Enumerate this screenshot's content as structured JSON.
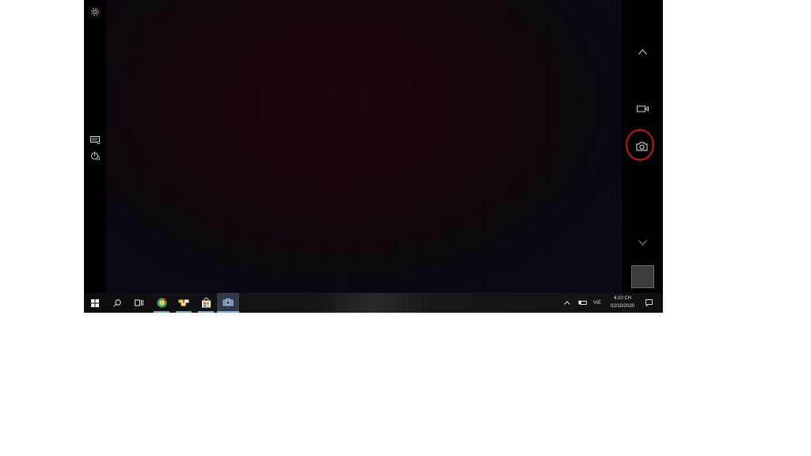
{
  "camera": {
    "side_tools": [
      "settings-icon",
      "hdr-icon",
      "self-timer-icon"
    ],
    "modes": [
      "chevron-up-icon",
      "video-icon",
      "photo-icon",
      "chevron-down-icon"
    ]
  },
  "taskbar": {
    "apps": [
      "start-icon",
      "search-icon",
      "task-view-icon",
      "chrome-icon",
      "file-explorer-icon",
      "store-icon",
      "camera-app-icon"
    ],
    "tray": {
      "language": "VIE",
      "time": "4:10 CH",
      "date": "02/10/2020"
    }
  },
  "colors": {
    "annotation": "#c8141c",
    "taskbar_active": "#7fb3e6"
  }
}
